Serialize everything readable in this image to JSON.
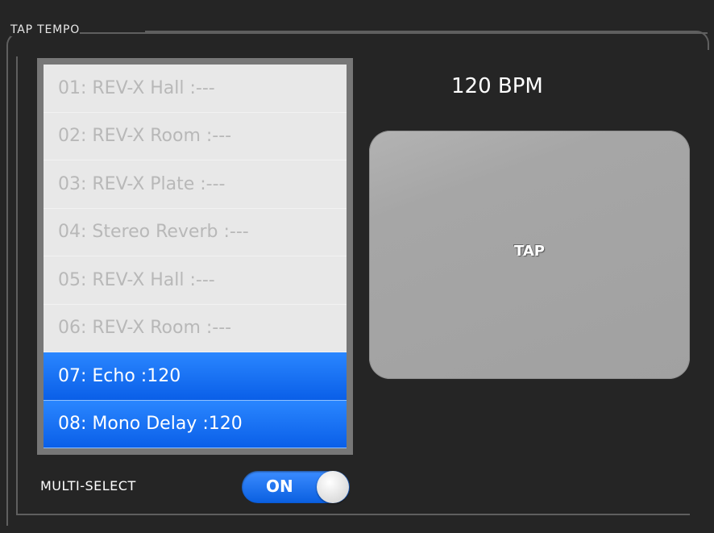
{
  "panel": {
    "title": "TAP TEMPO"
  },
  "effects_list": {
    "items": [
      {
        "label": "01: REV-X Hall :---",
        "selected": false
      },
      {
        "label": "02: REV-X Room :---",
        "selected": false
      },
      {
        "label": "03: REV-X Plate :---",
        "selected": false
      },
      {
        "label": "04: Stereo Reverb :---",
        "selected": false
      },
      {
        "label": "05: REV-X Hall :---",
        "selected": false
      },
      {
        "label": "06: REV-X Room :---",
        "selected": false
      },
      {
        "label": "07: Echo :120",
        "selected": true
      },
      {
        "label": "08: Mono Delay :120",
        "selected": true
      }
    ]
  },
  "tempo": {
    "display": "120 BPM"
  },
  "tap_button": {
    "label": "TAP"
  },
  "multi_select": {
    "label": "MULTI-SELECT",
    "state": "ON"
  },
  "colors": {
    "background": "#252525",
    "selected": "#0a6cf5",
    "list_background": "#e8e8e8",
    "tap_button": "#a6a6a6"
  }
}
